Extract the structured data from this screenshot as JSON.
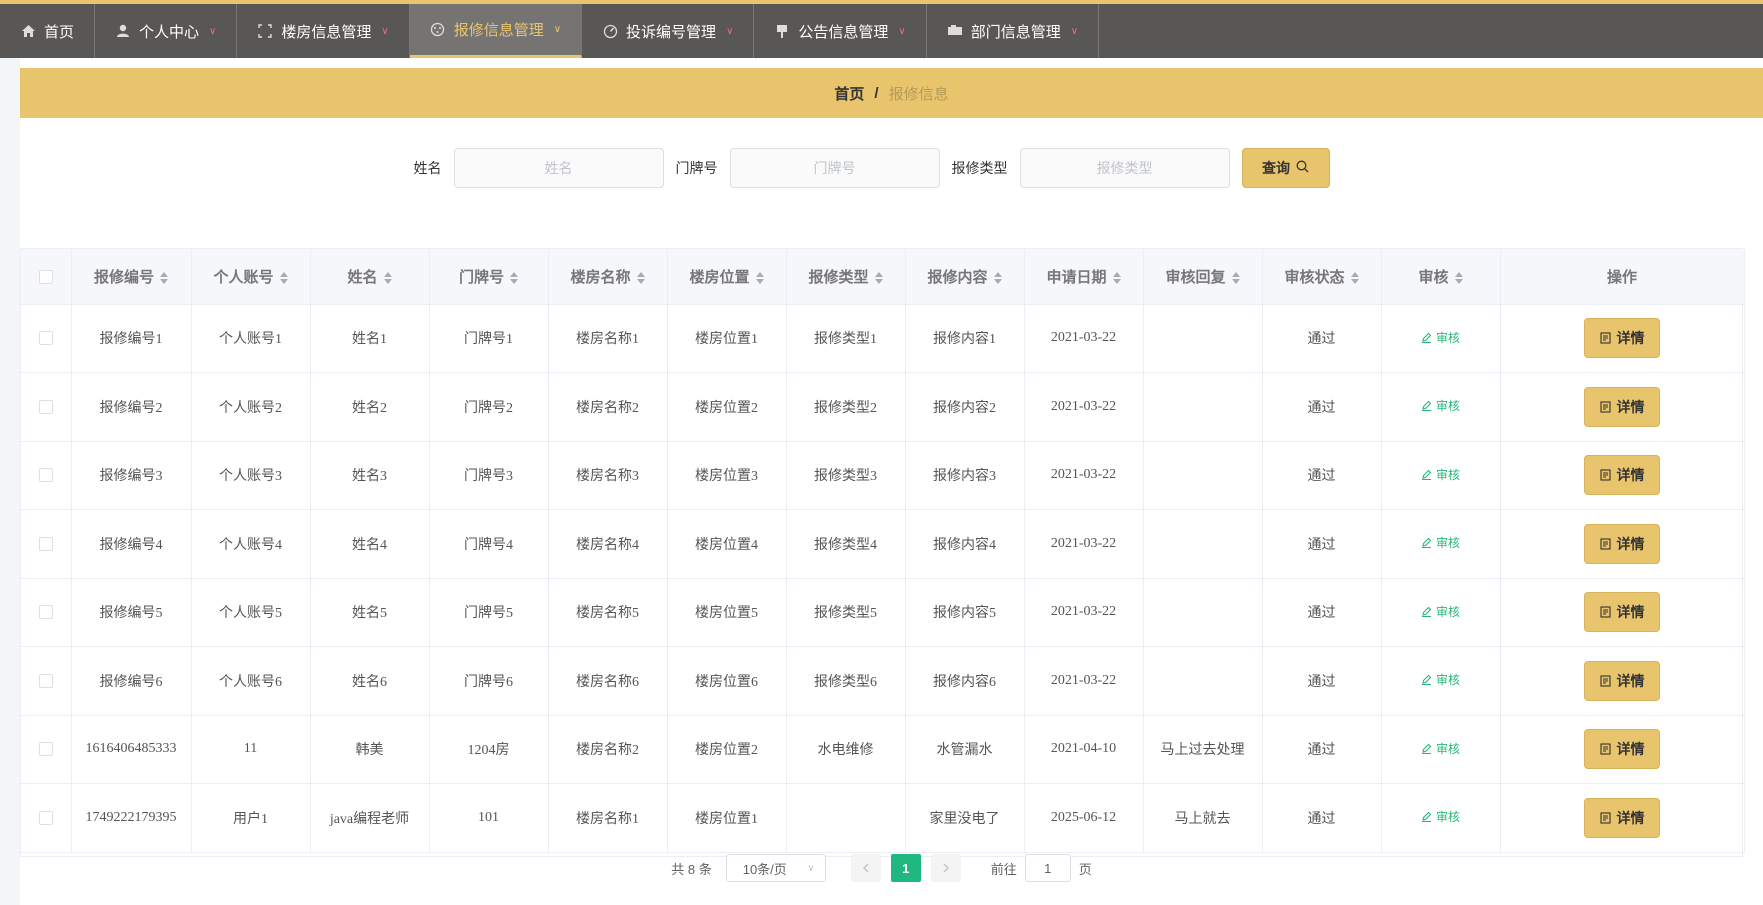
{
  "nav": {
    "items": [
      {
        "label": "首页",
        "icon": "home-icon",
        "dropdown": false
      },
      {
        "label": "个人中心",
        "icon": "user-icon",
        "dropdown": true
      },
      {
        "label": "楼房信息管理",
        "icon": "building-icon",
        "dropdown": true
      },
      {
        "label": "报修信息管理",
        "icon": "repair-icon",
        "dropdown": true,
        "active": true
      },
      {
        "label": "投诉编号管理",
        "icon": "complaint-icon",
        "dropdown": true
      },
      {
        "label": "公告信息管理",
        "icon": "notice-icon",
        "dropdown": true
      },
      {
        "label": "部门信息管理",
        "icon": "department-icon",
        "dropdown": true
      }
    ]
  },
  "breadcrumb": {
    "home": "首页",
    "separator": "/",
    "current": "报修信息"
  },
  "search": {
    "name_label": "姓名",
    "name_placeholder": "姓名",
    "name_value": "",
    "door_label": "门牌号",
    "door_placeholder": "门牌号",
    "door_value": "",
    "type_label": "报修类型",
    "type_placeholder": "报修类型",
    "type_value": "",
    "query_label": "查询"
  },
  "table": {
    "columns": [
      "报修编号",
      "个人账号",
      "姓名",
      "门牌号",
      "楼房名称",
      "楼房位置",
      "报修类型",
      "报修内容",
      "申请日期",
      "审核回复",
      "审核状态",
      "审核",
      "操作"
    ],
    "audit_label": "审核",
    "detail_label": "详情",
    "rows": [
      [
        "报修编号1",
        "个人账号1",
        "姓名1",
        "门牌号1",
        "楼房名称1",
        "楼房位置1",
        "报修类型1",
        "报修内容1",
        "2021-03-22",
        "",
        "通过"
      ],
      [
        "报修编号2",
        "个人账号2",
        "姓名2",
        "门牌号2",
        "楼房名称2",
        "楼房位置2",
        "报修类型2",
        "报修内容2",
        "2021-03-22",
        "",
        "通过"
      ],
      [
        "报修编号3",
        "个人账号3",
        "姓名3",
        "门牌号3",
        "楼房名称3",
        "楼房位置3",
        "报修类型3",
        "报修内容3",
        "2021-03-22",
        "",
        "通过"
      ],
      [
        "报修编号4",
        "个人账号4",
        "姓名4",
        "门牌号4",
        "楼房名称4",
        "楼房位置4",
        "报修类型4",
        "报修内容4",
        "2021-03-22",
        "",
        "通过"
      ],
      [
        "报修编号5",
        "个人账号5",
        "姓名5",
        "门牌号5",
        "楼房名称5",
        "楼房位置5",
        "报修类型5",
        "报修内容5",
        "2021-03-22",
        "",
        "通过"
      ],
      [
        "报修编号6",
        "个人账号6",
        "姓名6",
        "门牌号6",
        "楼房名称6",
        "楼房位置6",
        "报修类型6",
        "报修内容6",
        "2021-03-22",
        "",
        "通过"
      ],
      [
        "1616406485333",
        "11",
        "韩美",
        "1204房",
        "楼房名称2",
        "楼房位置2",
        "水电维修",
        "水管漏水",
        "2021-04-10",
        "马上过去处理",
        "通过"
      ],
      [
        "1749222179395",
        "用户1",
        "java编程老师",
        "101",
        "楼房名称1",
        "楼房位置1",
        "",
        "家里没电了",
        "2025-06-12",
        "马上就去",
        "通过"
      ]
    ]
  },
  "pagination": {
    "total": "共 8 条",
    "page_size": "10条/页",
    "current_page": "1",
    "goto_label": "前往",
    "goto_value": "1",
    "page_suffix": "页"
  },
  "colors": {
    "accent": "#e8c56d",
    "nav_bg": "#595756",
    "success": "#1fb880"
  }
}
